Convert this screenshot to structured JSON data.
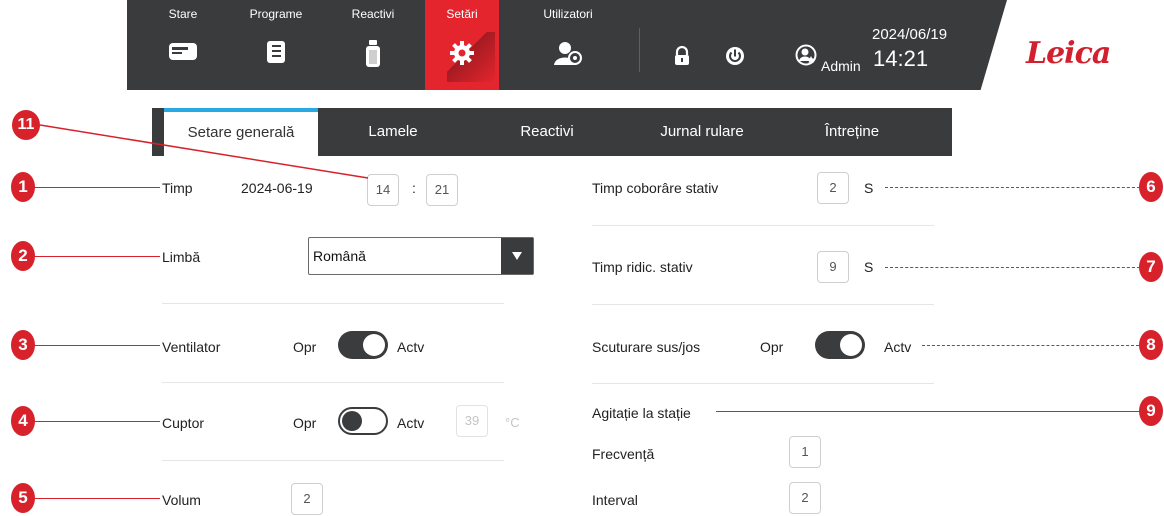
{
  "nav": {
    "tabs": [
      {
        "label": "Stare",
        "icon": "instrument-icon"
      },
      {
        "label": "Programe",
        "icon": "program-icon"
      },
      {
        "label": "Reactivi",
        "icon": "reagent-bottle-icon"
      },
      {
        "label": "Setări",
        "icon": "gear-icon",
        "active": true
      },
      {
        "label": "Utilizatori",
        "icon": "user-settings-icon"
      }
    ],
    "user": "Admin",
    "date": "2024/06/19",
    "time": "14:21"
  },
  "brand": {
    "logo": "Leica",
    "color": "#d2202f"
  },
  "subtabs": [
    "Setare generală",
    "Lamele",
    "Reactivi",
    "Jurnal rulare",
    "Întreține"
  ],
  "general": {
    "time": {
      "label": "Timp",
      "date": "2024-06-19",
      "hour": "14",
      "separator": ":",
      "minute": "21"
    },
    "language": {
      "label": "Limbă",
      "value": "Română"
    },
    "fan": {
      "label": "Ventilator",
      "off": "Opr",
      "on": "Actv",
      "state": "on"
    },
    "oven": {
      "label": "Cuptor",
      "off": "Opr",
      "on": "Actv",
      "state": "off",
      "temp": "39",
      "unit": "°C"
    },
    "volume": {
      "label": "Volum",
      "value": "2"
    },
    "lower_time": {
      "label": "Timp coborâre stativ",
      "value": "2",
      "unit": "S"
    },
    "raise_time": {
      "label": "Timp ridic. stativ",
      "value": "9",
      "unit": "S"
    },
    "shake": {
      "label": "Scuturare sus/jos",
      "off": "Opr",
      "on": "Actv",
      "state": "on"
    },
    "agitation": {
      "label": "Agitație la stație",
      "frequency_label": "Frecvență",
      "frequency": "1",
      "interval_label": "Interval",
      "interval": "2"
    }
  },
  "callouts": {
    "c1": "1",
    "c2": "2",
    "c3": "3",
    "c4": "4",
    "c5": "5",
    "c6": "6",
    "c7": "7",
    "c8": "8",
    "c9": "9",
    "c11": "11"
  },
  "colors": {
    "accent": "#e4252e",
    "bar": "#3a3b3d",
    "tab_highlight": "#29a9e1",
    "callout": "#d7222c"
  }
}
